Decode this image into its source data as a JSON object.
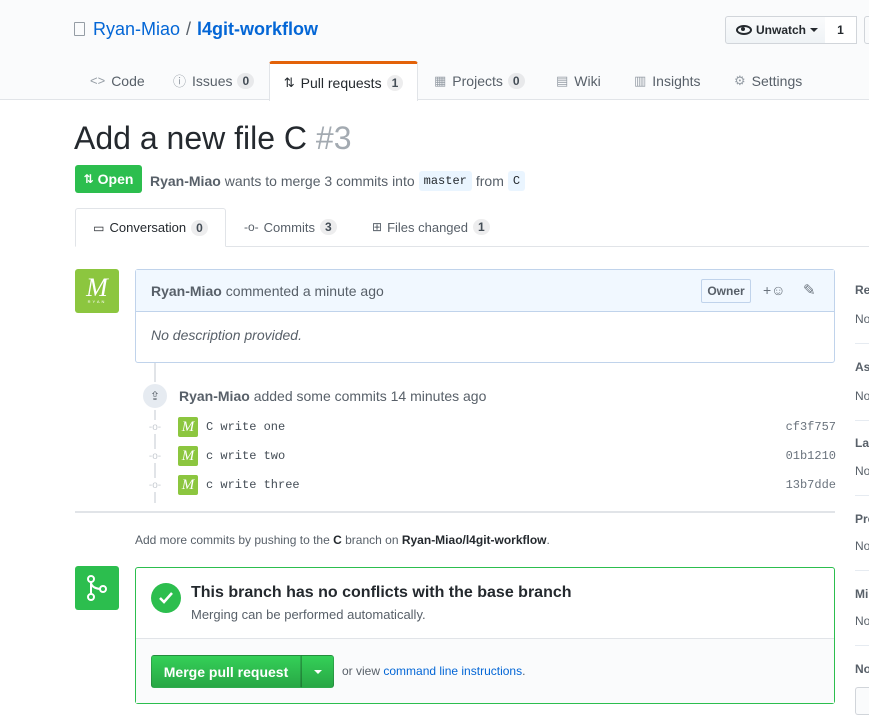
{
  "repo": {
    "owner": "Ryan-Miao",
    "separator": "/",
    "name": "l4git-workflow"
  },
  "watch": {
    "label": "Unwatch",
    "count": "1"
  },
  "nav_tabs": [
    {
      "icon": "<>",
      "label": "Code",
      "count": ""
    },
    {
      "icon": "ⓘ",
      "label": "Issues",
      "count": "0"
    },
    {
      "icon": "⇅",
      "label": "Pull requests",
      "count": "1"
    },
    {
      "icon": "▦",
      "label": "Projects",
      "count": "0"
    },
    {
      "icon": "▤",
      "label": "Wiki",
      "count": ""
    },
    {
      "icon": "▥",
      "label": "Insights",
      "count": ""
    },
    {
      "icon": "⚙",
      "label": "Settings",
      "count": ""
    }
  ],
  "pr": {
    "title": "Add a new file C",
    "number": "#3",
    "state": "Open",
    "author": "Ryan-Miao",
    "meta_text": "wants to merge 3 commits into",
    "base": "master",
    "from": "from",
    "head": "C"
  },
  "pr_tabs": [
    {
      "label": "Conversation",
      "count": "0"
    },
    {
      "label": "Commits",
      "count": "3"
    },
    {
      "label": "Files changed",
      "count": "1"
    }
  ],
  "comment": {
    "author": "Ryan-Miao",
    "action": "commented a minute ago",
    "badge": "Owner",
    "reaction": "+☺",
    "body": "No description provided.",
    "avatar_letter": "M",
    "avatar_caption": "RYAN"
  },
  "push": {
    "author": "Ryan-Miao",
    "text": "added some commits 14 minutes ago"
  },
  "commits": [
    {
      "message": "C write one",
      "sha": "cf3f757"
    },
    {
      "message": "c write two",
      "sha": "01b1210"
    },
    {
      "message": "c write three",
      "sha": "13b7dde"
    }
  ],
  "hint": {
    "prefix": "Add more commits by pushing to the",
    "branch": "C",
    "middle": "branch on",
    "repo": "Ryan-Miao/l4git-workflow",
    "suffix": "."
  },
  "merge": {
    "title": "This branch has no conflicts with the base branch",
    "subtitle": "Merging can be performed automatically.",
    "button": "Merge pull request",
    "alt_prefix": "or view",
    "alt_link": "command line instructions",
    "alt_suffix": "."
  },
  "sidebar": [
    {
      "head": "Re",
      "value": "No"
    },
    {
      "head": "As",
      "value": "No"
    },
    {
      "head": "La",
      "value": "No"
    },
    {
      "head": "Pro",
      "value": "No"
    },
    {
      "head": "Mi",
      "value": "No"
    },
    {
      "head": "No",
      "value": ""
    }
  ],
  "colors": {
    "accent": "#0366d6",
    "green": "#2cbe4e",
    "tab_highlight": "#e36209",
    "avatar": "#8cc63f"
  }
}
